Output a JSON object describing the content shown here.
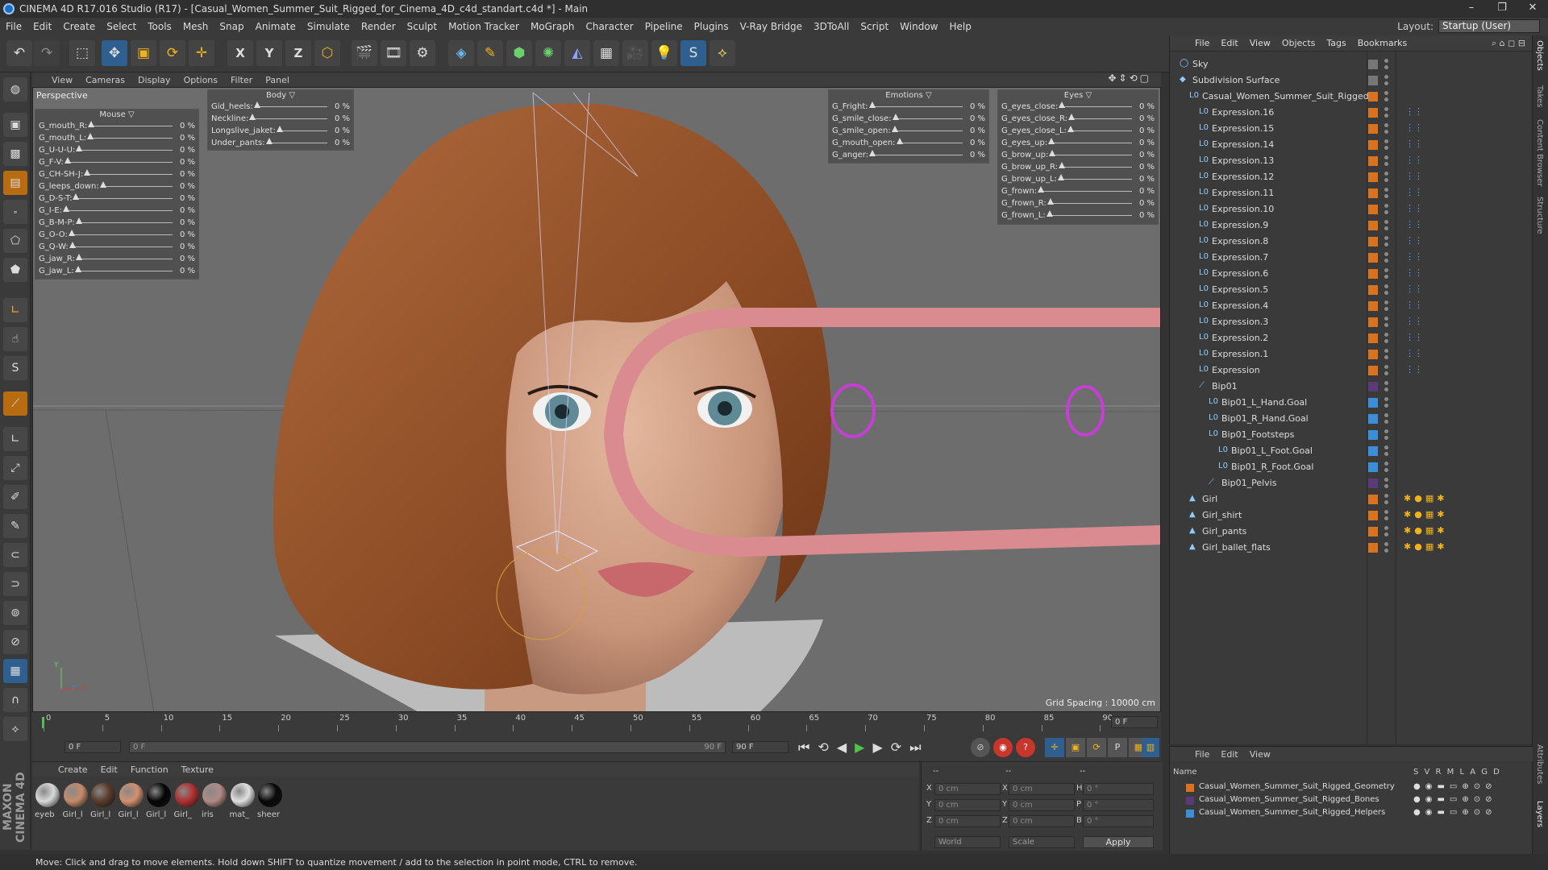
{
  "app": {
    "title": "CINEMA 4D R17.016 Studio (R17) - [Casual_Women_Summer_Suit_Rigged_for_Cinema_4D_c4d_standart.c4d *] - Main",
    "window_min": "–",
    "window_max": "❐",
    "window_close": "✕"
  },
  "menu": [
    "File",
    "Edit",
    "Create",
    "Select",
    "Tools",
    "Mesh",
    "Snap",
    "Animate",
    "Simulate",
    "Render",
    "Sculpt",
    "Motion Tracker",
    "MoGraph",
    "Character",
    "Pipeline",
    "Plugins",
    "V-Ray Bridge",
    "3DToAll",
    "Script",
    "Window",
    "Help"
  ],
  "layout": {
    "label": "Layout:",
    "value": "Startup (User)"
  },
  "toolbar": {
    "x_axis": "X",
    "y_axis": "Y",
    "z_axis": "Z"
  },
  "viewport": {
    "menu": [
      "View",
      "Cameras",
      "Display",
      "Options",
      "Filter",
      "Panel"
    ],
    "icons": "✥⇕⟲▢",
    "name": "Perspective",
    "grid_spacing": "Grid Spacing : 10000 cm",
    "axis_y": "Y",
    "axis_x": "x",
    "axis_z": "z"
  },
  "panels": {
    "mouse": {
      "title": "Mouse",
      "rows": [
        {
          "name": "G_mouth_R:",
          "value": "0 %"
        },
        {
          "name": "G_mouth_L:",
          "value": "0 %"
        },
        {
          "name": "G_U-U-U:",
          "value": "0 %"
        },
        {
          "name": "G_F-V:",
          "value": "0 %"
        },
        {
          "name": "G_CH-SH-J:",
          "value": "0 %"
        },
        {
          "name": "G_leeps_down:",
          "value": "0 %"
        },
        {
          "name": "G_D-S-T:",
          "value": "0 %"
        },
        {
          "name": "G_I-E:",
          "value": "0 %"
        },
        {
          "name": "G_B-M-P:",
          "value": "0 %"
        },
        {
          "name": "G_O-O:",
          "value": "0 %"
        },
        {
          "name": "G_Q-W:",
          "value": "0 %"
        },
        {
          "name": "G_jaw_R:",
          "value": "0 %"
        },
        {
          "name": "G_jaw_L:",
          "value": "0 %"
        }
      ]
    },
    "body": {
      "title": "Body",
      "rows": [
        {
          "name": "Gid_heels:",
          "value": "0 %"
        },
        {
          "name": "Neckline:",
          "value": "0 %"
        },
        {
          "name": "Longslive_jaket:",
          "value": "0 %"
        },
        {
          "name": "Under_pants:",
          "value": "0 %"
        }
      ]
    },
    "emotions": {
      "title": "Emotions",
      "rows": [
        {
          "name": "G_Fright:",
          "value": "0 %"
        },
        {
          "name": "G_smile_close:",
          "value": "0 %"
        },
        {
          "name": "G_smile_open:",
          "value": "0 %"
        },
        {
          "name": "G_mouth_open:",
          "value": "0 %"
        },
        {
          "name": "G_anger:",
          "value": "0 %"
        }
      ]
    },
    "eyes": {
      "title": "Eyes",
      "rows": [
        {
          "name": "G_eyes_close:",
          "value": "0 %"
        },
        {
          "name": "G_eyes_close_R:",
          "value": "0 %"
        },
        {
          "name": "G_eyes_close_L:",
          "value": "0 %"
        },
        {
          "name": "G_eyes_up:",
          "value": "0 %"
        },
        {
          "name": "G_brow_up:",
          "value": "0 %"
        },
        {
          "name": "G_brow_up_R:",
          "value": "0 %"
        },
        {
          "name": "G_brow_up_L:",
          "value": "0 %"
        },
        {
          "name": "G_frown:",
          "value": "0 %"
        },
        {
          "name": "G_frown_R:",
          "value": "0 %"
        },
        {
          "name": "G_frown_L:",
          "value": "0 %"
        }
      ]
    }
  },
  "timeline": {
    "ticks": [
      "0",
      "5",
      "10",
      "15",
      "20",
      "25",
      "30",
      "35",
      "40",
      "45",
      "50",
      "55",
      "60",
      "65",
      "70",
      "75",
      "80",
      "85",
      "90"
    ],
    "current_frame": "0 F",
    "start_frame": "0 F",
    "range_start": "0 F",
    "range_end": "90 F",
    "end_frame": "90 F"
  },
  "transport_icons": [
    "⏮",
    "⟲",
    "◀",
    "▶",
    "▶",
    "⟳",
    "⏭"
  ],
  "materials": {
    "menu": [
      "Create",
      "Edit",
      "Function",
      "Texture"
    ],
    "items": [
      {
        "label": "eyeb",
        "color": "#d8d8d8"
      },
      {
        "label": "Girl_l",
        "color": "#c58a6a"
      },
      {
        "label": "Girl_l",
        "color": "#5a3b2a"
      },
      {
        "label": "Girl_l",
        "color": "#d09070"
      },
      {
        "label": "Girl_l",
        "color": "#050505"
      },
      {
        "label": "Girl_",
        "color": "#b03030"
      },
      {
        "label": "iris",
        "color": "#b08a85"
      },
      {
        "label": "mat_",
        "color": "#e0e0e0"
      },
      {
        "label": "sheer",
        "color": "#080808"
      }
    ]
  },
  "coords": {
    "header_a": "--",
    "header_b": "--",
    "header_c": "--",
    "rows": [
      {
        "a": "X",
        "av": "0 cm",
        "b": "X",
        "bv": "0 cm",
        "c": "H",
        "cv": "0 °"
      },
      {
        "a": "Y",
        "av": "0 cm",
        "b": "Y",
        "bv": "0 cm",
        "c": "P",
        "cv": "0 °"
      },
      {
        "a": "Z",
        "av": "0 cm",
        "b": "Z",
        "bv": "0 cm",
        "c": "B",
        "cv": "0 °"
      }
    ],
    "mode": "World",
    "scale": "Scale",
    "apply": "Apply"
  },
  "status": "Move: Click and drag to move elements. Hold down SHIFT to quantize movement / add to the selection in point mode, CTRL to remove.",
  "objects": {
    "menu": [
      "File",
      "Edit",
      "View",
      "Objects",
      "Tags",
      "Bookmarks"
    ],
    "items": [
      {
        "name": "Sky",
        "indent": 0,
        "icon": "◯",
        "color": "#777"
      },
      {
        "name": "Subdivision Surface",
        "indent": 0,
        "icon": "◆",
        "color": "#777"
      },
      {
        "name": "Casual_Women_Summer_Suit_Rigged",
        "indent": 1,
        "icon": "L0",
        "color": "#d9731f"
      },
      {
        "name": "Expression.16",
        "indent": 2,
        "icon": "L0",
        "color": "#d9731f"
      },
      {
        "name": "Expression.15",
        "indent": 2,
        "icon": "L0",
        "color": "#d9731f"
      },
      {
        "name": "Expression.14",
        "indent": 2,
        "icon": "L0",
        "color": "#d9731f"
      },
      {
        "name": "Expression.13",
        "indent": 2,
        "icon": "L0",
        "color": "#d9731f"
      },
      {
        "name": "Expression.12",
        "indent": 2,
        "icon": "L0",
        "color": "#d9731f"
      },
      {
        "name": "Expression.11",
        "indent": 2,
        "icon": "L0",
        "color": "#d9731f"
      },
      {
        "name": "Expression.10",
        "indent": 2,
        "icon": "L0",
        "color": "#d9731f"
      },
      {
        "name": "Expression.9",
        "indent": 2,
        "icon": "L0",
        "color": "#d9731f"
      },
      {
        "name": "Expression.8",
        "indent": 2,
        "icon": "L0",
        "color": "#d9731f"
      },
      {
        "name": "Expression.7",
        "indent": 2,
        "icon": "L0",
        "color": "#d9731f"
      },
      {
        "name": "Expression.6",
        "indent": 2,
        "icon": "L0",
        "color": "#d9731f"
      },
      {
        "name": "Expression.5",
        "indent": 2,
        "icon": "L0",
        "color": "#d9731f"
      },
      {
        "name": "Expression.4",
        "indent": 2,
        "icon": "L0",
        "color": "#d9731f"
      },
      {
        "name": "Expression.3",
        "indent": 2,
        "icon": "L0",
        "color": "#d9731f"
      },
      {
        "name": "Expression.2",
        "indent": 2,
        "icon": "L0",
        "color": "#d9731f"
      },
      {
        "name": "Expression.1",
        "indent": 2,
        "icon": "L0",
        "color": "#d9731f"
      },
      {
        "name": "Expression",
        "indent": 2,
        "icon": "L0",
        "color": "#d9731f"
      },
      {
        "name": "Bip01",
        "indent": 2,
        "icon": "⟋",
        "color": "#5a3a78"
      },
      {
        "name": "Bip01_L_Hand.Goal",
        "indent": 3,
        "icon": "L0",
        "color": "#3d8ed9"
      },
      {
        "name": "Bip01_R_Hand.Goal",
        "indent": 3,
        "icon": "L0",
        "color": "#3d8ed9"
      },
      {
        "name": "Bip01_Footsteps",
        "indent": 3,
        "icon": "L0",
        "color": "#3d8ed9"
      },
      {
        "name": "Bip01_L_Foot.Goal",
        "indent": 4,
        "icon": "L0",
        "color": "#3d8ed9"
      },
      {
        "name": "Bip01_R_Foot.Goal",
        "indent": 4,
        "icon": "L0",
        "color": "#3d8ed9"
      },
      {
        "name": "Bip01_Pelvis",
        "indent": 3,
        "icon": "⟋",
        "color": "#5a3a78"
      },
      {
        "name": "Girl",
        "indent": 1,
        "icon": "▲",
        "color": "#d9731f"
      },
      {
        "name": "Girl_shirt",
        "indent": 1,
        "icon": "▲",
        "color": "#d9731f"
      },
      {
        "name": "Girl_pants",
        "indent": 1,
        "icon": "▲",
        "color": "#d9731f"
      },
      {
        "name": "Girl_ballet_flats",
        "indent": 1,
        "icon": "▲",
        "color": "#d9731f"
      }
    ]
  },
  "side_tabs": [
    "Objects",
    "Takes",
    "Content Browser",
    "Structure",
    "Attributes",
    "Layers"
  ],
  "layers": {
    "menu": [
      "File",
      "Edit",
      "View"
    ],
    "header_name": "Name",
    "header_cols": "S V R M L A G D",
    "items": [
      {
        "name": "Casual_Women_Summer_Suit_Rigged_Geometry",
        "color": "#d9731f"
      },
      {
        "name": "Casual_Women_Summer_Suit_Rigged_Bones",
        "color": "#5a3a78"
      },
      {
        "name": "Casual_Women_Summer_Suit_Rigged_Helpers",
        "color": "#3d8ed9"
      }
    ]
  },
  "brand": "MAXON CINEMA 4D"
}
